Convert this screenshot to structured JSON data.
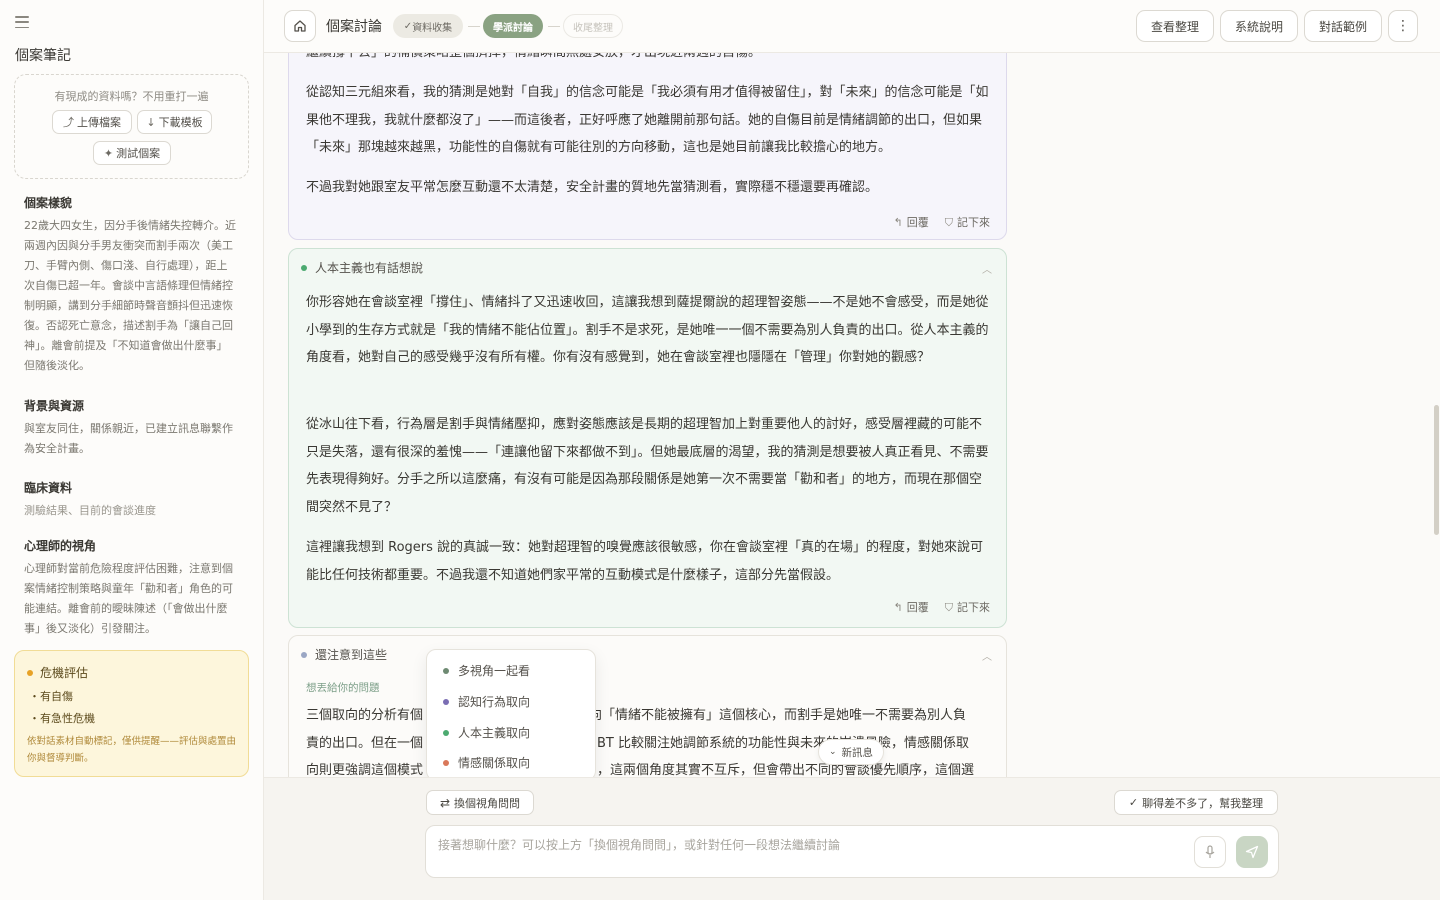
{
  "sidebar": {
    "title": "個案筆記",
    "upload_hint": "有現成的資料嗎？不用重打一遍",
    "upload_button": "上傳檔案",
    "template_button": "下載模板",
    "test_case_button": "測試個案",
    "sections": [
      {
        "heading": "個案樣貌",
        "body": "22歲大四女生，因分手後情緒失控轉介。近兩週內因與分手男友衝突而割手兩次（美工刀、手臂內側、傷口淺、自行處理），距上次自傷已超一年。會談中言語條理但情緒控制明顯，講到分手細節時聲音顫抖但迅速恢復。否認死亡意念，描述割手為「讓自己回神」。離會前提及「不知道會做出什麼事」但隨後淡化。"
      },
      {
        "heading": "背景與資源",
        "body": "與室友同住，關係親近，已建立訊息聯繫作為安全計畫。"
      },
      {
        "heading": "臨床資料",
        "body": "測驗結果、目前的會談進度"
      },
      {
        "heading": "心理師的視角",
        "body": "心理師對當前危險程度評估困難，注意到個案情緒控制策略與童年「勸和者」角色的可能連結。離會前的曖昧陳述（「會做出什麼事」後又淡化）引發關注。"
      }
    ],
    "crisis": {
      "title": "危機評估",
      "items": [
        "有自傷",
        "有急性危機"
      ],
      "note": "依對話素材自動標記，僅供提醒——評估與處置由你與督導判斷。"
    }
  },
  "header": {
    "title": "個案討論",
    "steps": [
      "資料收集",
      "學派討論",
      "收尾整理"
    ],
    "buttons": [
      "查看整理",
      "系統說明",
      "對話範例"
    ]
  },
  "cards": {
    "cbt": {
      "partial_top": "繼續撐下去」的補償策略整個擠掉，情緒瞬間無處安放，才出現近兩週的自傷。",
      "paragraphs": [
        "從認知三元組來看，我的猜測是她對「自我」的信念可能是「我必須有用才值得被留住」，對「未來」的信念可能是「如果他不理我，我就什麼都沒了」——而這後者，正好呼應了她離開前那句話。她的自傷目前是情緒調節的出口，但如果「未來」那塊越來越黑，功能性的自傷就有可能往別的方向移動，這也是她目前讓我比較擔心的地方。",
        "不過我對她跟室友平常怎麼互動還不太清楚，安全計畫的質地先當猜測看，實際穩不穩還要再確認。"
      ],
      "reply": "回覆",
      "save": "記下來"
    },
    "humanistic": {
      "title": "人本主義也有話想說",
      "paragraphs": [
        "你形容她在會談室裡「撐住」、情緒抖了又迅速收回，這讓我想到薩提爾說的超理智姿態——不是她不會感受，而是她從小學到的生存方式就是「我的情緒不能佔位置」。割手不是求死，是她唯一一個不需要為別人負責的出口。從人本主義的角度看，她對自己的感受幾乎沒有所有權。你有沒有感覺到，她在會談室裡也隱隱在「管理」你對她的觀感？",
        "從冰山往下看，行為層是割手與情緒壓抑，應對姿態應該是長期的超理智加上對重要他人的討好，感受層裡藏的可能不只是失落，還有很深的羞愧——「連讓他留下來都做不到」。但她最底層的渴望，我的猜測是想要被人真正看見、不需要先表現得夠好。分手之所以這麼痛，有沒有可能是因為那段關係是她第一次不需要當「勸和者」的地方，而現在那個空間突然不見了？",
        "這裡讓我想到 Rogers 說的真誠一致：她對超理智的嗅覺應該很敏感，你在會談室裡「真的在場」的程度，對她來說可能比任何技術都重要。不過我還不知道她們家平常的互動模式是什麼樣子，這部分先當假設。"
      ],
      "reply": "回覆",
      "save": "記下來"
    },
    "notes": {
      "title": "還注意到這些",
      "subhint": "想丟給你的問題",
      "line1_left": "三個取向的分析有個",
      "line1_right": "向「情緒不能被擁有」這個核心，而割手是她唯一不需要為別人負",
      "line2_left": "責的出口。但在一個",
      "line2_right": "BT 比較關注她調節系統的功能性與未來的崩潰風險，情感關係取",
      "line3_left": "向則更強調這個模式",
      "line3_right": "，這兩個角度其實不互斥，但會帶出不同的會談優先順序，這個選"
    }
  },
  "popup": {
    "items": [
      {
        "label": "多視角一起看",
        "color": "#6e8a72"
      },
      {
        "label": "認知行為取向",
        "color": "#7a6db3"
      },
      {
        "label": "人本主義取向",
        "color": "#4caa70"
      },
      {
        "label": "情感關係取向",
        "color": "#d9785a"
      }
    ]
  },
  "new_message": "新訊息",
  "composer": {
    "switch_perspective": "換個視角問問",
    "summarize": "聊得差不多了，幫我整理",
    "placeholder": "接著想聊什麼？可以按上方「換個視角問問」，或針對任何一段想法繼續討論"
  },
  "colors": {
    "accent_green": "#8aa282",
    "cbt_dot": "#7a6db3",
    "humanistic_dot": "#4caa70",
    "crisis_dot": "#e7a227",
    "notes_dot": "#9aa6c4"
  }
}
